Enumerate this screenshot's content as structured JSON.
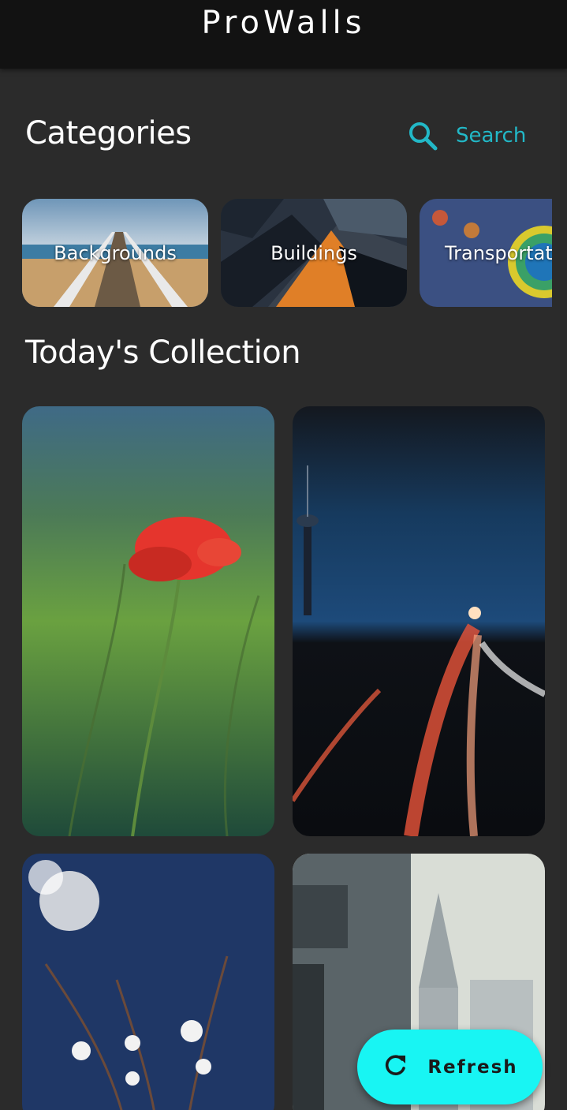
{
  "app": {
    "title": "ProWalls"
  },
  "categories": {
    "title": "Categories",
    "search_label": "Search",
    "items": [
      {
        "label": "Backgrounds"
      },
      {
        "label": "Buildings"
      },
      {
        "label": "Transportat"
      }
    ]
  },
  "collection": {
    "title": "Today's Collection"
  },
  "fab": {
    "label": "Refresh"
  },
  "colors": {
    "accent": "#22b8c7",
    "fab": "#18f5f3",
    "background": "#2b2b2b",
    "appbar": "#121212"
  }
}
